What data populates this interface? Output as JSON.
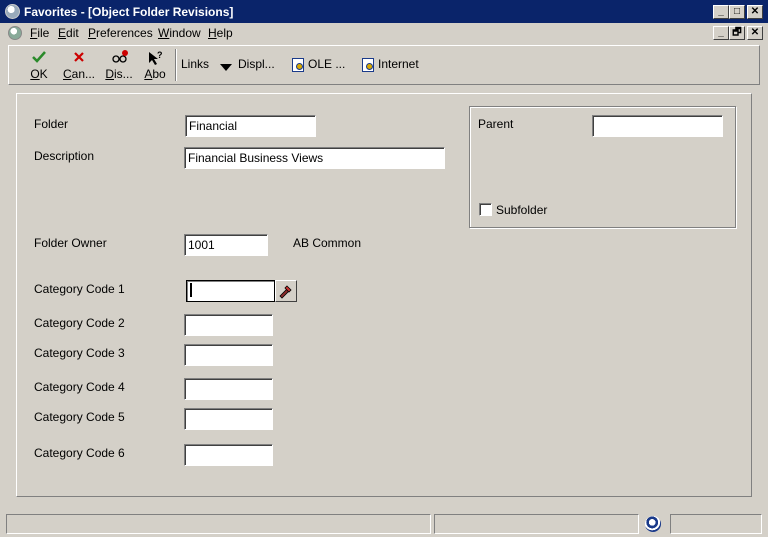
{
  "window": {
    "title": "Favorites - [Object Folder Revisions]",
    "controls": [
      "_",
      "□",
      "✕"
    ]
  },
  "menu": {
    "items": [
      "File",
      "Edit",
      "Preferences",
      "Window",
      "Help"
    ],
    "mdi_controls": [
      "_",
      "🗗",
      "✕"
    ]
  },
  "toolbar": {
    "ok_label": "OK",
    "cancel_label": "Can...",
    "display_label": "Dis...",
    "about_label": "Abo",
    "links_label": "Links",
    "display_menu_label": "Displ...",
    "ole_label": "OLE ...",
    "internet_label": "Internet"
  },
  "form": {
    "folder_label": "Folder",
    "folder_value": "Financial",
    "description_label": "Description",
    "description_value": "Financial Business Views",
    "parent_label": "Parent",
    "parent_value": "",
    "subfolder_label": "Subfolder",
    "owner_label": "Folder Owner",
    "owner_value": "1001",
    "owner_name": "AB Common",
    "category_codes": [
      {
        "label": "Category Code 1",
        "value": ""
      },
      {
        "label": "Category Code 2",
        "value": ""
      },
      {
        "label": "Category Code 3",
        "value": ""
      },
      {
        "label": "Category Code 4",
        "value": ""
      },
      {
        "label": "Category Code 5",
        "value": ""
      },
      {
        "label": "Category Code 6",
        "value": ""
      }
    ]
  },
  "status": {
    "pane1": "",
    "pane2": "",
    "pane3": ""
  },
  "icons": {
    "app": "app-globe-icon",
    "ok": "checkmark-icon",
    "cancel": "x-icon",
    "display": "glasses-icon",
    "about": "question-pointer-icon",
    "dropdown": "triangle-down-icon",
    "exit": "exit-document-icon",
    "lookup": "flashlight-icon",
    "status": "globe-icon"
  },
  "colors": {
    "titlebar": "#0a246a",
    "face": "#d4d0c8",
    "ok_green": "#2a8a2a",
    "cancel_red": "#cc0000"
  }
}
